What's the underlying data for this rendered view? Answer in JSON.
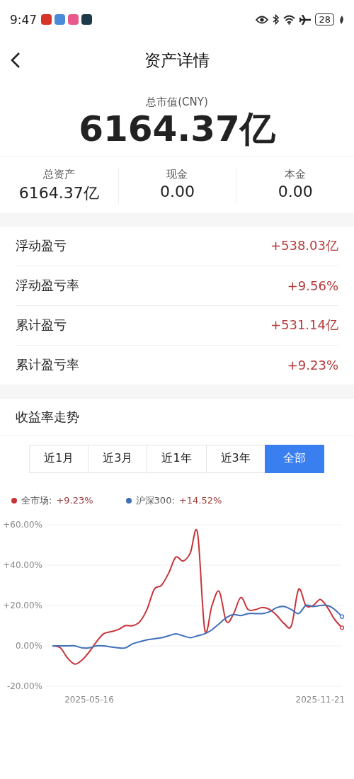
{
  "status_bar": {
    "time": "9:47",
    "battery": "28"
  },
  "header": {
    "title": "资产详情"
  },
  "summary": {
    "label": "总市值(CNY)",
    "value": "6164.37亿"
  },
  "stats": [
    {
      "label": "总资产",
      "value": "6164.37亿"
    },
    {
      "label": "现金",
      "value": "0.00"
    },
    {
      "label": "本金",
      "value": "0.00"
    }
  ],
  "metrics": [
    {
      "label": "浮动盈亏",
      "value": "+538.03亿"
    },
    {
      "label": "浮动盈亏率",
      "value": "+9.56%"
    },
    {
      "label": "累计盈亏",
      "value": "+531.14亿"
    },
    {
      "label": "累计盈亏率",
      "value": "+9.23%"
    }
  ],
  "trend": {
    "title": "收益率走势",
    "periods": [
      {
        "label": "近1月",
        "selected": false
      },
      {
        "label": "近3月",
        "selected": false
      },
      {
        "label": "近1年",
        "selected": false
      },
      {
        "label": "近3年",
        "selected": false
      },
      {
        "label": "全部",
        "selected": true
      }
    ],
    "legend": [
      {
        "separator": ":",
        "value": "+9.23%"
      },
      {
        "separator": ":",
        "value": "+14.52%"
      }
    ],
    "chart_data": {
      "type": "line",
      "categories": [
        null,
        null,
        null,
        null,
        null,
        "2025-05-16",
        null,
        null,
        null,
        null,
        null,
        null,
        null,
        null,
        null,
        null,
        null,
        null,
        null,
        null,
        null,
        null,
        null,
        null,
        null,
        null,
        null,
        null,
        null,
        null,
        null,
        null,
        null,
        null,
        null,
        null,
        null,
        "2025-11-21",
        null,
        null,
        null
      ],
      "series": [
        {
          "name": "全市场",
          "color": "#c8333a",
          "values": [
            0,
            -1,
            -6,
            -9,
            -7,
            -3,
            2,
            6,
            7,
            8,
            10,
            10,
            12,
            18,
            28,
            30,
            36,
            44,
            42,
            46,
            56,
            8,
            20,
            27,
            12,
            16,
            24,
            18,
            18,
            19,
            18,
            15,
            11,
            10,
            28,
            20,
            20,
            23,
            19,
            13,
            9
          ]
        },
        {
          "name": "沪深300",
          "color": "#3f6fb8",
          "values": [
            0,
            0,
            0,
            0,
            -1,
            -1,
            0,
            0,
            -0.5,
            -1,
            -1,
            1,
            2,
            3,
            3.5,
            4,
            5,
            6,
            5,
            4,
            5,
            6,
            8,
            11,
            14,
            15.5,
            15,
            16,
            16,
            16,
            17,
            19,
            19.5,
            18,
            16,
            20,
            19.5,
            20,
            20,
            18,
            14.5
          ]
        }
      ],
      "ylim": [
        -20,
        60
      ],
      "grid": true,
      "yticks": [
        {
          "value": 60,
          "label": "+60.00%"
        },
        {
          "value": 40,
          "label": "+40.00%"
        },
        {
          "value": 20,
          "label": "+20.00%"
        },
        {
          "value": 0,
          "label": "0.00%"
        },
        {
          "value": -20,
          "label": "-20.00%"
        }
      ]
    }
  }
}
